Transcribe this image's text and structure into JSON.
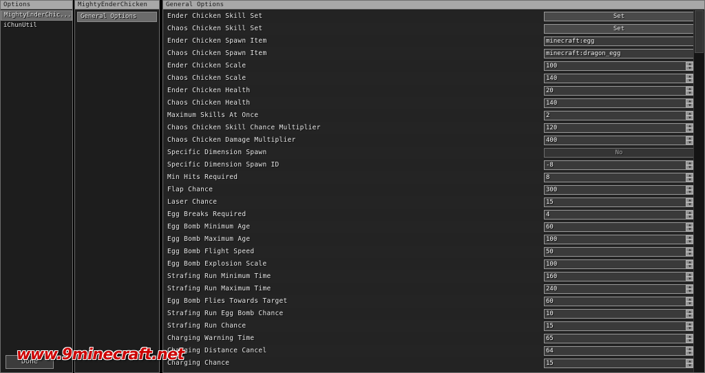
{
  "colors": {
    "header_bg": "#a8a8a8",
    "panel_bg": "#1d1d1d",
    "content_bg": "#242424",
    "field_bg": "#3a3a3a",
    "field_border": "#9a9a9a",
    "text": "#e8e8e8",
    "watermark": "#cc0000"
  },
  "mods_panel": {
    "title": "Options",
    "items": [
      {
        "label": "MightyEnderChic...",
        "selected": true
      },
      {
        "label": "iChunUtil",
        "selected": false
      }
    ]
  },
  "categories_panel": {
    "title": "MightyEnderChicken",
    "items": [
      {
        "label": "General Options",
        "selected": true
      }
    ]
  },
  "options_panel": {
    "title": "General Options",
    "rows": [
      {
        "label": "Ender Chicken Skill Set",
        "type": "button",
        "value": "Set"
      },
      {
        "label": "Chaos Chicken Skill Set",
        "type": "button",
        "value": "Set"
      },
      {
        "label": "Ender Chicken Spawn Item",
        "type": "text",
        "value": "minecraft:egg"
      },
      {
        "label": "Chaos Chicken Spawn Item",
        "type": "text",
        "value": "minecraft:dragon_egg"
      },
      {
        "label": "Ender Chicken Scale",
        "type": "spin",
        "value": "100"
      },
      {
        "label": "Chaos Chicken Scale",
        "type": "spin",
        "value": "140"
      },
      {
        "label": "Ender Chicken Health",
        "type": "spin",
        "value": "20"
      },
      {
        "label": "Chaos Chicken Health",
        "type": "spin",
        "value": "140"
      },
      {
        "label": "Maximum Skills At Once",
        "type": "spin",
        "value": "2"
      },
      {
        "label": "Chaos Chicken Skill Chance Multiplier",
        "type": "spin",
        "value": "120"
      },
      {
        "label": "Chaos Chicken Damage Multiplier",
        "type": "spin",
        "value": "400"
      },
      {
        "label": "Specific Dimension Spawn",
        "type": "toggle",
        "value": "No"
      },
      {
        "label": "Specific Dimension Spawn ID",
        "type": "spin",
        "value": "-8"
      },
      {
        "label": "Min Hits Required",
        "type": "spin",
        "value": "8"
      },
      {
        "label": "Flap Chance",
        "type": "spin",
        "value": "300"
      },
      {
        "label": "Laser Chance",
        "type": "spin",
        "value": "15"
      },
      {
        "label": "Egg Breaks Required",
        "type": "spin",
        "value": "4"
      },
      {
        "label": "Egg Bomb Minimum Age",
        "type": "spin",
        "value": "60"
      },
      {
        "label": "Egg Bomb Maximum Age",
        "type": "spin",
        "value": "100"
      },
      {
        "label": "Egg Bomb Flight Speed",
        "type": "spin",
        "value": "50"
      },
      {
        "label": "Egg Bomb Explosion Scale",
        "type": "spin",
        "value": "100"
      },
      {
        "label": "Strafing Run Minimum Time",
        "type": "spin",
        "value": "160"
      },
      {
        "label": "Strafing Run Maximum Time",
        "type": "spin",
        "value": "240"
      },
      {
        "label": "Egg Bomb Flies Towards Target",
        "type": "spin",
        "value": "60"
      },
      {
        "label": "Strafing Run Egg Bomb Chance",
        "type": "spin",
        "value": "10"
      },
      {
        "label": "Strafing Run Chance",
        "type": "spin",
        "value": "15"
      },
      {
        "label": "Charging Warning Time",
        "type": "spin",
        "value": "65"
      },
      {
        "label": "Charging Distance Cancel",
        "type": "spin",
        "value": "64"
      },
      {
        "label": "Charging Chance",
        "type": "spin",
        "value": "15"
      }
    ]
  },
  "footer": {
    "done_label": "Done"
  },
  "watermark": {
    "text": "www.9minecraft.net"
  }
}
